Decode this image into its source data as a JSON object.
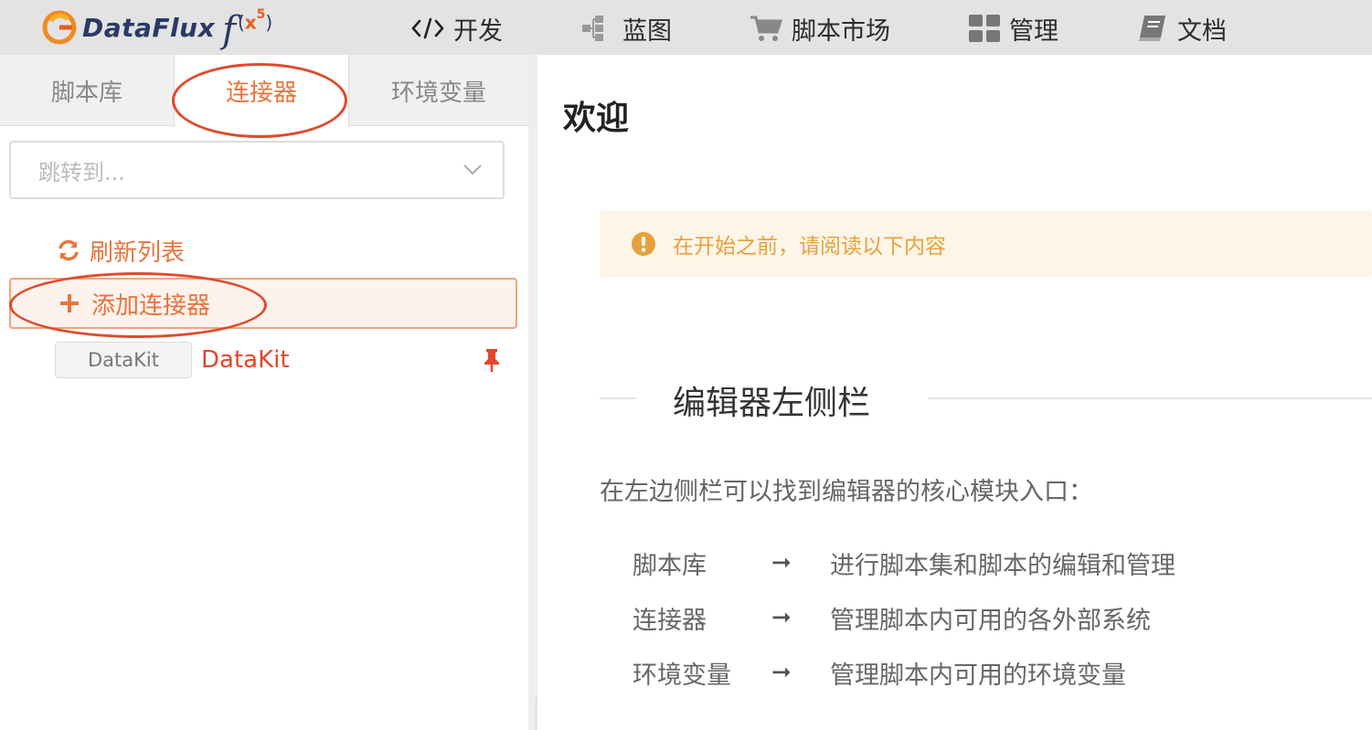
{
  "app": {
    "logo_text": "DataFlux",
    "logo_suffix_f": "f",
    "logo_suffix_x": "x",
    "logo_suffix_sup": "5"
  },
  "topnav": [
    {
      "label": "开发",
      "icon": "code-icon"
    },
    {
      "label": "蓝图",
      "icon": "blueprint-icon"
    },
    {
      "label": "脚本市场",
      "icon": "cart-icon"
    },
    {
      "label": "管理",
      "icon": "grid-icon"
    },
    {
      "label": "文档",
      "icon": "book-icon"
    }
  ],
  "sidebar": {
    "tabs": [
      {
        "label": "脚本库",
        "active": false
      },
      {
        "label": "连接器",
        "active": true
      },
      {
        "label": "环境变量",
        "active": false
      }
    ],
    "jump_placeholder": "跳转到...",
    "refresh_label": "刷新列表",
    "add_label": "添加连接器",
    "connectors": [
      {
        "tag": "DataKit",
        "name": "DataKit",
        "pinned": true
      }
    ]
  },
  "main": {
    "title": "欢迎",
    "notice": "在开始之前，请阅读以下内容",
    "section_title": "编辑器左侧栏",
    "intro": "在左边侧栏可以找到编辑器的核心模块入口：",
    "features": [
      {
        "name": "脚本库",
        "arrow": "➞",
        "desc": "进行脚本集和脚本的编辑和管理"
      },
      {
        "name": "连接器",
        "arrow": "➞",
        "desc": "管理脚本内可用的各外部系统"
      },
      {
        "name": "环境变量",
        "arrow": "➞",
        "desc": "管理脚本内可用的环境变量"
      }
    ]
  },
  "colors": {
    "accent": "#e8743b",
    "annotation": "#e04a2c",
    "notice_text": "#e6a23c",
    "pin": "#e5452a"
  }
}
